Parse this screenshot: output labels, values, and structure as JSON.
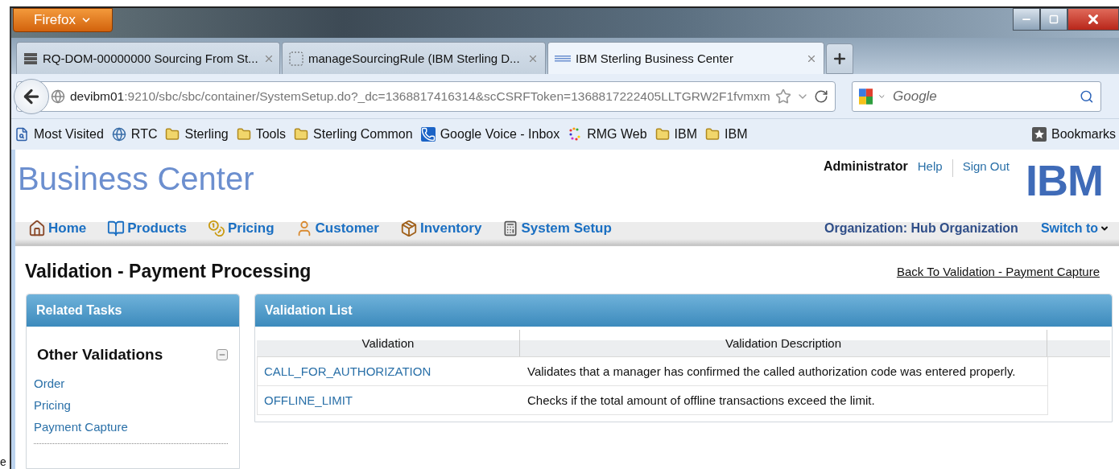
{
  "browser": {
    "app_menu": "Firefox",
    "tabs": [
      {
        "title": "RQ-DOM-00000000 Sourcing From St...",
        "selected": false
      },
      {
        "title": "manageSourcingRule (IBM Sterling D...",
        "selected": false
      },
      {
        "title": "IBM Sterling Business Center",
        "selected": true
      }
    ],
    "url": {
      "host": "devibm01",
      "rest": ":9210/sbc/sbc/container/SystemSetup.do?_dc=1368817416314&scCSRFToken=1368817222405LLTGRW2F1fvmxm"
    },
    "search": {
      "placeholder": "Google"
    },
    "bookmarks": [
      "Most Visited",
      "RTC",
      "Sterling",
      "Tools",
      "Sterling Common",
      "Google Voice - Inbox",
      "RMG Web",
      "IBM",
      "IBM"
    ],
    "bookmarks_menu": "Bookmarks"
  },
  "header": {
    "title": "Business Center",
    "user": "Administrator",
    "links": [
      "Help",
      "Sign Out"
    ],
    "logo": "IBM"
  },
  "nav": {
    "items": [
      "Home",
      "Products",
      "Pricing",
      "Customer",
      "Inventory",
      "System Setup"
    ],
    "organization": "Organization: Hub Organization",
    "switch": "Switch to"
  },
  "page": {
    "title": "Validation - Payment Processing",
    "back_link": "Back To Validation - Payment Capture"
  },
  "related_tasks": {
    "title": "Related Tasks",
    "section": {
      "title": "Other Validations",
      "expanded": true,
      "links": [
        "Order",
        "Pricing",
        "Payment Capture"
      ]
    }
  },
  "validation_list": {
    "title": "Validation List",
    "columns": [
      "Validation",
      "Validation Description"
    ],
    "rows": [
      {
        "validation": "CALL_FOR_AUTHORIZATION",
        "description": "Validates that a manager has confirmed the called authorization code was entered properly."
      },
      {
        "validation": "OFFLINE_LIMIT",
        "description": "Checks if the total amount of offline transactions exceed the limit."
      }
    ]
  },
  "edge_text": "e"
}
